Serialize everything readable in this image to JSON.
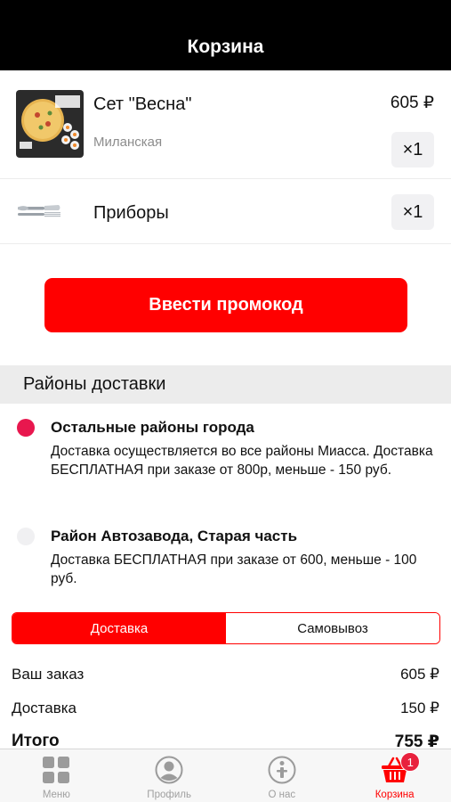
{
  "header": {
    "title": "Корзина"
  },
  "cart": {
    "items": [
      {
        "title": "Сет \"Весна\"",
        "subtitle": "Миланская",
        "price": "605 ₽",
        "qty": "×1"
      },
      {
        "title": "Приборы",
        "qty": "×1"
      }
    ]
  },
  "promo": {
    "button_label": "Ввести промокод"
  },
  "delivery_zones": {
    "heading": "Районы доставки",
    "zones": [
      {
        "title": "Остальные районы города",
        "description": "Доставка осуществляется во все районы Миасса. Доставка БЕСПЛАТНАЯ при заказе от 800р, меньше - 150 руб.",
        "selected": true
      },
      {
        "title": "Район Автозавода, Старая часть",
        "description": "Доставка БЕСПЛАТНАЯ при заказе от 600, меньше - 100 руб.",
        "selected": false
      }
    ]
  },
  "delivery_mode": {
    "options": [
      "Доставка",
      "Самовывоз"
    ],
    "selected": "Доставка"
  },
  "summary": {
    "order_label": "Ваш заказ",
    "order_value": "605 ₽",
    "delivery_label": "Доставка",
    "delivery_value": "150 ₽",
    "total_label": "Итого",
    "total_value": "755 ₽"
  },
  "tabbar": {
    "tabs": [
      {
        "label": "Меню",
        "icon": "grid-icon"
      },
      {
        "label": "Профиль",
        "icon": "profile-icon"
      },
      {
        "label": "О нас",
        "icon": "info-icon"
      },
      {
        "label": "Корзина",
        "icon": "basket-icon",
        "badge": "1"
      }
    ],
    "active": "Корзина"
  },
  "colors": {
    "accent": "#ff0000",
    "radio_selected": "#e8174e",
    "header_bg": "#000000"
  }
}
